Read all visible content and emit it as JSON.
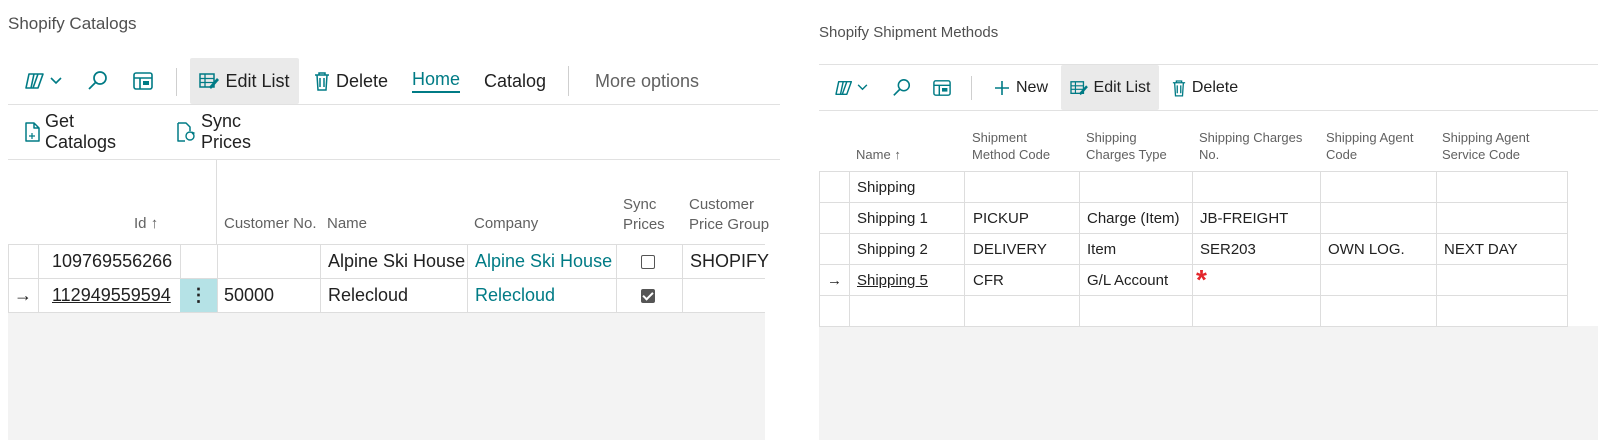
{
  "left": {
    "title": "Shopify Catalogs",
    "toolbar": {
      "edit_list": "Edit List",
      "delete": "Delete",
      "home": "Home",
      "catalog": "Catalog",
      "more_options": "More options"
    },
    "actions": {
      "get_catalogs": "Get Catalogs",
      "sync_prices": "Sync Prices"
    },
    "columns": {
      "id": "Id",
      "customer_no": "Customer No.",
      "name": "Name",
      "company": "Company",
      "sync_prices_1": "Sync",
      "sync_prices_2": "Prices",
      "price_group_1": "Customer",
      "price_group_2": "Price Group"
    },
    "rows": [
      {
        "id": "109769556266",
        "customer_no": "",
        "name": "Alpine Ski House",
        "company": "Alpine Ski House",
        "sync_prices": false,
        "price_group": "SHOPIFY"
      },
      {
        "id": "112949559594",
        "customer_no": "50000",
        "name": "Relecloud",
        "company": "Relecloud",
        "sync_prices": true,
        "price_group": ""
      }
    ],
    "row_menu_glyph": "⋮",
    "current_row_glyph": "→",
    "sort_glyph": "↑"
  },
  "right": {
    "title": "Shopify Shipment Methods",
    "toolbar": {
      "new": "New",
      "edit_list": "Edit List",
      "delete": "Delete"
    },
    "columns": {
      "name": "Name",
      "method_code_1": "Shipment",
      "method_code_2": "Method Code",
      "charges_type_1": "Shipping",
      "charges_type_2": "Charges Type",
      "charges_no_1": "Shipping Charges",
      "charges_no_2": "No.",
      "agent_code_1": "Shipping Agent",
      "agent_code_2": "Code",
      "agent_service_1": "Shipping Agent",
      "agent_service_2": "Service Code"
    },
    "rows": [
      {
        "name": "Shipping",
        "method_code": "",
        "charges_type": "",
        "charges_no": "",
        "agent_code": "",
        "agent_service": ""
      },
      {
        "name": "Shipping 1",
        "method_code": "PICKUP",
        "charges_type": "Charge (Item)",
        "charges_no": "JB-FREIGHT",
        "agent_code": "",
        "agent_service": ""
      },
      {
        "name": "Shipping 2",
        "method_code": "DELIVERY",
        "charges_type": "Item",
        "charges_no": "SER203",
        "agent_code": "OWN LOG.",
        "agent_service": "NEXT DAY"
      },
      {
        "name": "Shipping 5",
        "method_code": "CFR",
        "charges_type": "G/L Account",
        "charges_no": "*",
        "agent_code": "",
        "agent_service": ""
      }
    ],
    "current_row_glyph": "→",
    "sort_glyph": "↑"
  },
  "colors": {
    "accent": "#007b85",
    "required": "#e3262b",
    "selected_bg": "#eaeaea",
    "grid_bg": "#f3f3f3"
  },
  "icons": [
    "filter-pane-icon",
    "chevron-down-icon",
    "search-icon",
    "layout-icon",
    "edit-list-icon",
    "trash-icon",
    "document-icon",
    "sync-prices-icon",
    "plus-icon"
  ]
}
